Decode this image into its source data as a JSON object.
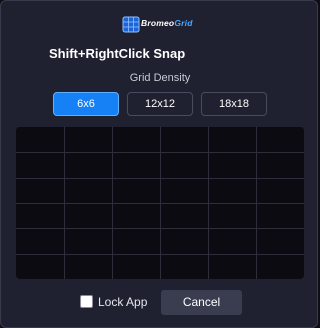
{
  "app": {
    "logo_prefix": "Bromeo",
    "logo_suffix": "Grid",
    "logo_icon": "grid-app-icon"
  },
  "header": {
    "title": "Shift+RightClick Snap"
  },
  "density": {
    "label": "Grid Density",
    "options": [
      "6x6",
      "12x12",
      "18x18"
    ],
    "selected": "6x6"
  },
  "preview": {
    "columns": 6,
    "rows": 6
  },
  "footer": {
    "lock_label": "Lock App",
    "lock_checked": false,
    "cancel_label": "Cancel"
  },
  "colors": {
    "accent": "#1581f5",
    "window_bg": "#1f2030",
    "grid_bg": "#0b0b11",
    "grid_lines": "#2d2e3a"
  }
}
